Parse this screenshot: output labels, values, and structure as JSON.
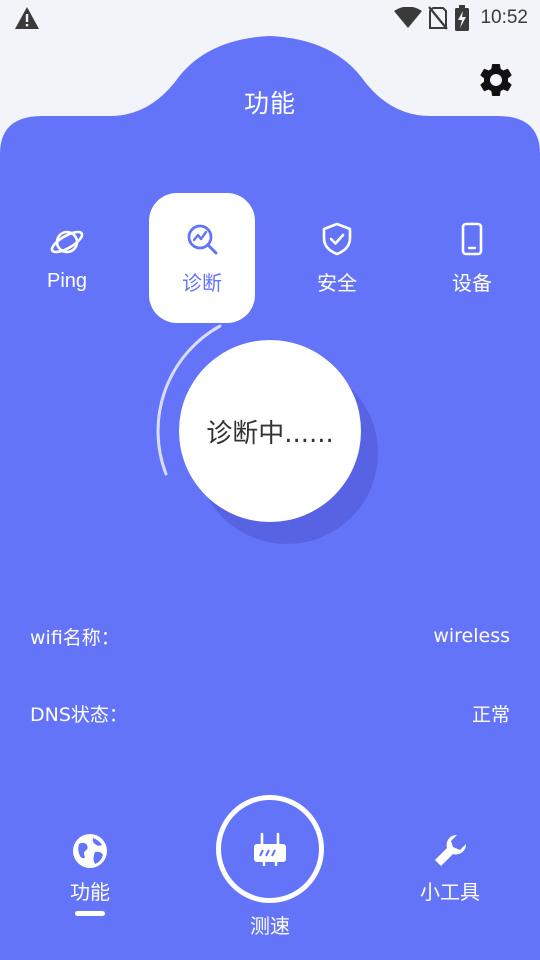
{
  "status_bar": {
    "time": "10:52",
    "icons": [
      "warning-icon",
      "wifi-icon",
      "no-sim-icon",
      "battery-charging-icon"
    ]
  },
  "header": {
    "title": "功能",
    "settings_icon": "gear-icon"
  },
  "tabs": [
    {
      "label": "Ping",
      "icon": "planet-icon",
      "active": false
    },
    {
      "label": "诊断",
      "icon": "search-chart-icon",
      "active": true
    },
    {
      "label": "安全",
      "icon": "shield-check-icon",
      "active": false
    },
    {
      "label": "设备",
      "icon": "phone-icon",
      "active": false
    }
  ],
  "diagnose": {
    "status": "诊断中......"
  },
  "info": {
    "rows": [
      {
        "label": "wifi名称：",
        "value": "wireless"
      },
      {
        "label": "DNS状态：",
        "value": "正常"
      }
    ]
  },
  "bottom_nav": {
    "items": [
      {
        "label": "功能",
        "icon": "globe-icon",
        "active": true
      },
      {
        "label": "测速",
        "icon": "router-icon",
        "active": false
      },
      {
        "label": "小工具",
        "icon": "wrench-icon",
        "active": false
      }
    ]
  },
  "colors": {
    "primary": "#6474f8",
    "background": "#f3f4f9",
    "active_text": "#6474f8",
    "shadow_circle": "#5763e3"
  }
}
